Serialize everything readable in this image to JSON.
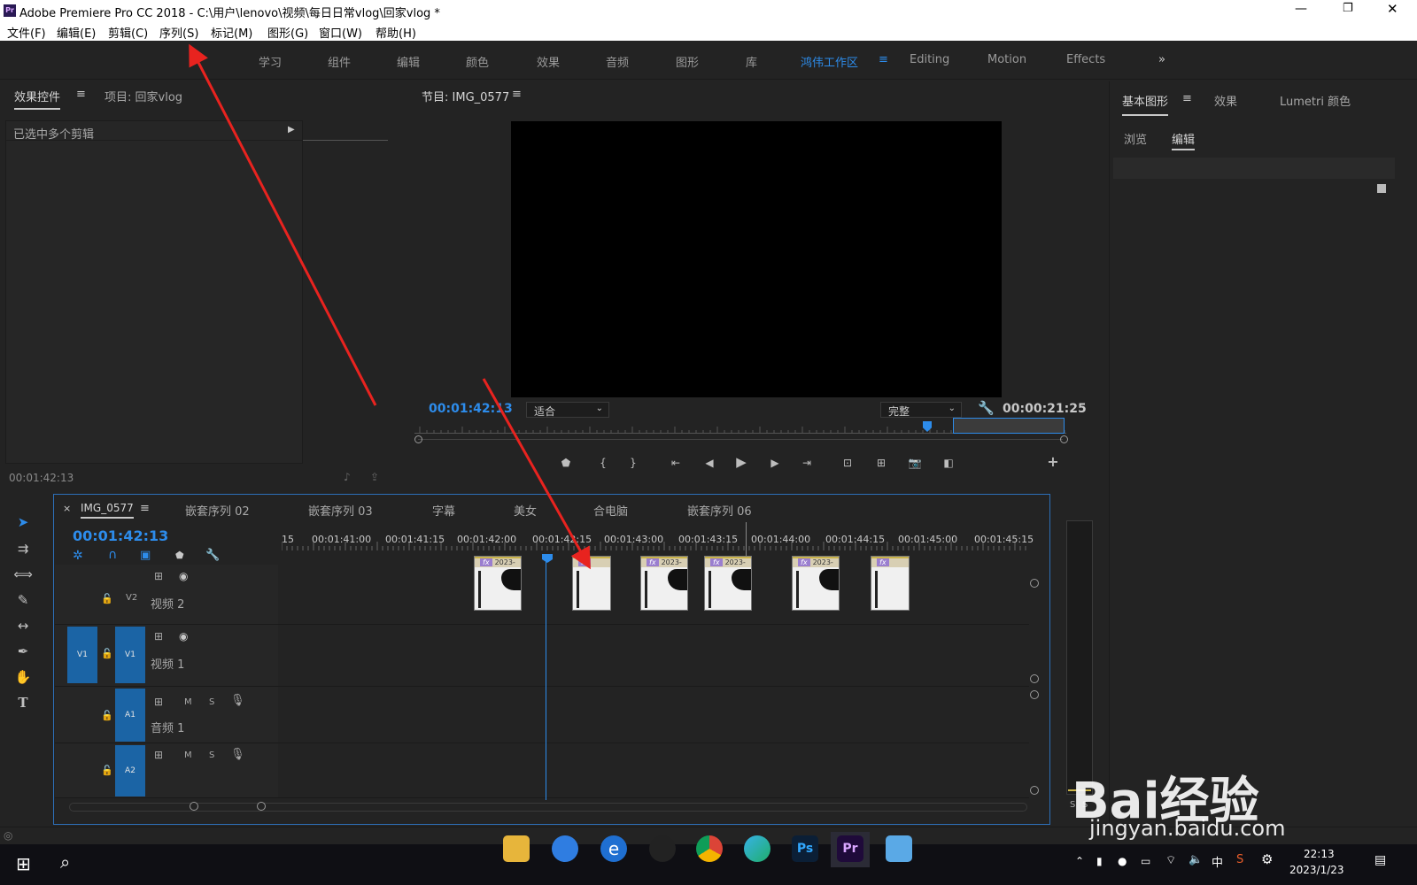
{
  "window": {
    "title": "Adobe Premiere Pro CC 2018 - C:\\用户\\lenovo\\视频\\每日日常vlog\\回家vlog *",
    "app_icon_label": "Pr"
  },
  "menu": [
    "文件(F)",
    "编辑(E)",
    "剪辑(C)",
    "序列(S)",
    "标记(M)",
    "图形(G)",
    "窗口(W)",
    "帮助(H)"
  ],
  "workspaces": {
    "items": [
      "学习",
      "组件",
      "编辑",
      "颜色",
      "效果",
      "音频",
      "图形",
      "库",
      "鸿伟工作区",
      "Editing",
      "Motion",
      "Effects"
    ],
    "active": "鸿伟工作区",
    "more": "»"
  },
  "effect_controls": {
    "tab_active": "效果控件",
    "tab_other": "项目: 回家vlog",
    "header_text": "已选中多个剪辑",
    "timecode": "00:01:42:13"
  },
  "program_monitor": {
    "tab": "节目: IMG_0577",
    "timecode_left": "00:01:42:13",
    "fit_value": "适合",
    "quality_value": "完整",
    "timecode_right": "00:00:21:25"
  },
  "essential_graphics": {
    "tabs": [
      "基本图形",
      "效果",
      "Lumetri 颜色"
    ],
    "subtabs": [
      "浏览",
      "编辑"
    ],
    "active_subtab": "编辑"
  },
  "timeline": {
    "tabs": [
      "IMG_0577",
      "嵌套序列 02",
      "嵌套序列 03",
      "字幕",
      "美女",
      "合电脑",
      "嵌套序列 06"
    ],
    "timecode": "00:01:42:13",
    "ruler_labels": [
      "15",
      "00:01:41:00",
      "00:01:41:15",
      "00:01:42:00",
      "00:01:42:15",
      "00:01:43:00",
      "00:01:43:15",
      "00:01:44:00",
      "00:01:44:15",
      "00:01:45:00",
      "00:01:45:15"
    ],
    "tracks": [
      {
        "id": "V2",
        "name": "视频 2"
      },
      {
        "id": "V1",
        "name": "视频 1",
        "source": "V1"
      },
      {
        "id": "A1",
        "name": "音频 1"
      },
      {
        "id": "A2",
        "name": ""
      }
    ],
    "clip_fx": "fx",
    "clip_label": "2023-",
    "track_m": "M",
    "track_s": "S"
  },
  "meter": {
    "labels": [
      "S",
      "S"
    ]
  },
  "taskbar": {
    "time": "22:13",
    "date": "2023/1/23",
    "ime": "中",
    "apps": [
      "file-explorer",
      "qq-browser",
      "ie",
      "qq",
      "chrome",
      "edge",
      "photoshop",
      "premiere",
      "notepad"
    ],
    "ps_label": "Ps",
    "pr_label": "Pr"
  },
  "watermark": {
    "text": "Bai经验",
    "url": "jingyan.baidu.com"
  },
  "colors": {
    "accent": "#2d8ceb",
    "track_blue": "#1b64a5",
    "annotation": "#e8231f"
  }
}
